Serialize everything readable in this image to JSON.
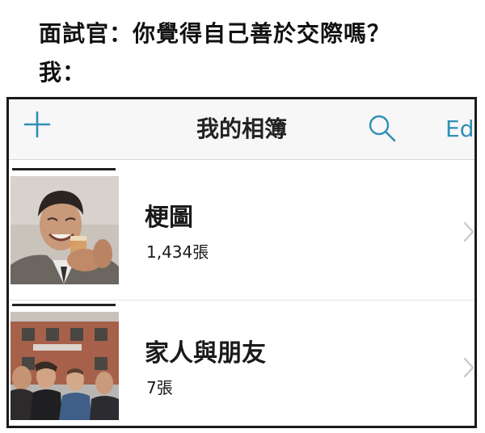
{
  "caption": {
    "line1": "面試官：你覺得自己善於交際嗎？",
    "line2": "我："
  },
  "navbar": {
    "title": "我的相簿",
    "edit_label": "Edi",
    "accent_color": "#2f8fb5"
  },
  "albums": [
    {
      "title": "梗圖",
      "count": "1,434張",
      "thumbnail": "man-laughing-with-drink-photo"
    },
    {
      "title": "家人與朋友",
      "count": "7張",
      "thumbnail": "group-of-friends-photo"
    }
  ],
  "icons": {
    "add": "plus-icon",
    "search": "magnifier-icon",
    "disclosure": "chevron-right-icon"
  }
}
